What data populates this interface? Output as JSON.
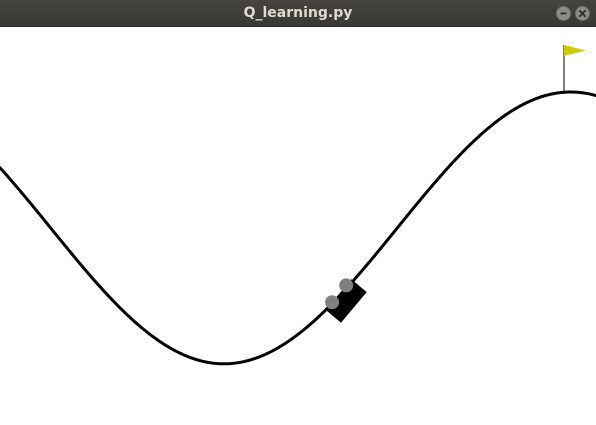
{
  "window": {
    "title": "Q_learning.py"
  },
  "controls": {
    "minimize_icon": "minimize-icon",
    "close_icon": "close-icon"
  },
  "scene": {
    "environment": "mountain-car",
    "colors": {
      "background": "#ffffff",
      "track": "#000000",
      "car_body": "#000000",
      "wheels": "#808080",
      "flag": "#cccc00",
      "flagpole": "#000000"
    }
  }
}
